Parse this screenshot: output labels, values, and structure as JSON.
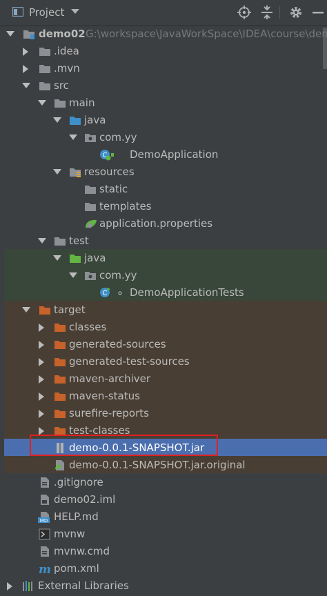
{
  "header": {
    "title": "Project",
    "icons": [
      "project-view-icon",
      "dropdown-icon",
      "locate-icon",
      "collapse-all-icon",
      "settings-icon",
      "hide-icon"
    ]
  },
  "colors": {
    "background": "#3c3f41",
    "test_band": "#39463a",
    "excluded_band": "#493e33",
    "selection": "#4b6eaf",
    "folder_gray": "#8c9094",
    "folder_blue": "#3f8fca",
    "folder_green": "#62b543",
    "folder_orange": "#c7622b",
    "annotation_box": "#e02020"
  },
  "tree": {
    "root": {
      "name": "demo02",
      "path": "G:\\workspace\\JavaWorkSpace\\IDEA\\course\\dem"
    },
    "items": [
      {
        "label": "demo02",
        "icon": "module-folder-icon"
      },
      {
        "label": ".idea",
        "icon": "folder-icon"
      },
      {
        "label": ".mvn",
        "icon": "folder-icon"
      },
      {
        "label": "src",
        "icon": "folder-icon"
      },
      {
        "label": "main",
        "icon": "folder-icon"
      },
      {
        "label": "java",
        "icon": "source-root-folder-icon"
      },
      {
        "label": "com.yy",
        "icon": "package-icon"
      },
      {
        "label": "DemoApplication",
        "icon": "spring-boot-class-icon"
      },
      {
        "label": "resources",
        "icon": "resources-folder-icon"
      },
      {
        "label": "static",
        "icon": "folder-icon"
      },
      {
        "label": "templates",
        "icon": "folder-icon"
      },
      {
        "label": "application.properties",
        "icon": "spring-properties-icon"
      },
      {
        "label": "test",
        "icon": "folder-icon"
      },
      {
        "label": "java",
        "icon": "test-root-folder-icon"
      },
      {
        "label": "com.yy",
        "icon": "package-icon"
      },
      {
        "label": "DemoApplicationTests",
        "icon": "test-class-icon"
      },
      {
        "label": "target",
        "icon": "excluded-folder-icon"
      },
      {
        "label": "classes",
        "icon": "excluded-folder-icon"
      },
      {
        "label": "generated-sources",
        "icon": "excluded-folder-icon"
      },
      {
        "label": "generated-test-sources",
        "icon": "excluded-folder-icon"
      },
      {
        "label": "maven-archiver",
        "icon": "excluded-folder-icon"
      },
      {
        "label": "maven-status",
        "icon": "excluded-folder-icon"
      },
      {
        "label": "surefire-reports",
        "icon": "excluded-folder-icon"
      },
      {
        "label": "test-classes",
        "icon": "excluded-folder-icon"
      },
      {
        "label": "demo-0.0.1-SNAPSHOT.jar",
        "icon": "jar-icon",
        "selected": true
      },
      {
        "label": "demo-0.0.1-SNAPSHOT.jar.original",
        "icon": "file-icon"
      },
      {
        "label": ".gitignore",
        "icon": "text-file-icon"
      },
      {
        "label": "demo02.iml",
        "icon": "iml-file-icon"
      },
      {
        "label": "HELP.md",
        "icon": "markdown-file-icon"
      },
      {
        "label": "mvnw",
        "icon": "shell-file-icon"
      },
      {
        "label": "mvnw.cmd",
        "icon": "text-file-icon"
      },
      {
        "label": "pom.xml",
        "icon": "maven-icon"
      },
      {
        "label": "External Libraries",
        "icon": "libraries-icon"
      }
    ]
  }
}
